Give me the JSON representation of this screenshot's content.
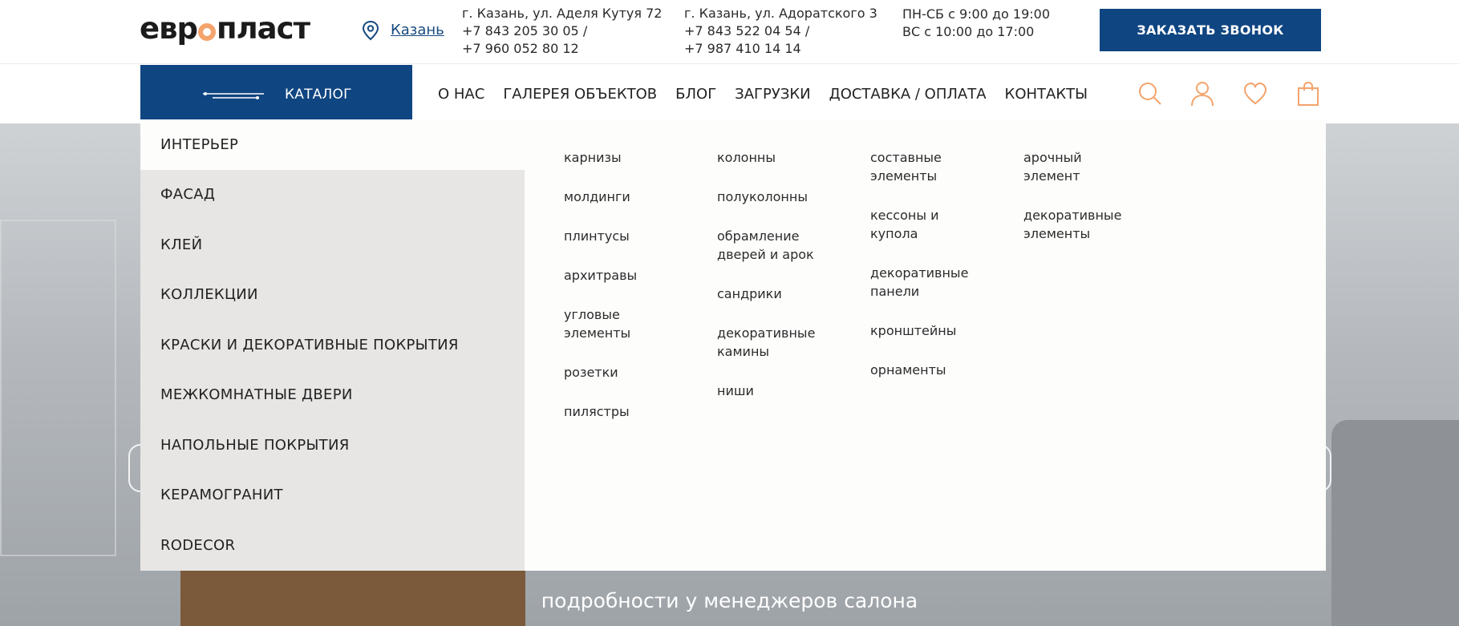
{
  "header": {
    "logo": {
      "before": "евр",
      "after": "пласт"
    },
    "city": "Казань",
    "address1": [
      "г. Казань, ул. Аделя Кутуя 72",
      "+7 843 205 30 05 /",
      "+7 960 052 80 12"
    ],
    "address2": [
      "г. Казань, ул. Адоратского 3",
      "+7 843 522 04 54 /",
      "+7 987 410 14 14"
    ],
    "hours": [
      "ПН-СБ с 9:00 до 19:00",
      "ВС с 10:00 до 17:00"
    ],
    "callback_label": "ЗАКАЗАТЬ ЗВОНОК"
  },
  "nav": {
    "catalog_label": "КАТАЛОГ",
    "links": [
      "О НАС",
      "ГАЛЕРЕЯ ОБЪЕКТОВ",
      "БЛОГ",
      "ЗАГРУЗКИ",
      "ДОСТАВКА / ОПЛАТА",
      "КОНТАКТЫ"
    ],
    "icons": [
      "search-icon",
      "user-icon",
      "heart-icon",
      "cart-icon"
    ]
  },
  "menu": {
    "categories": [
      "ИНТЕРЬЕР",
      "ФАСАД",
      "КЛЕЙ",
      "КОЛЛЕКЦИИ",
      "КРАСКИ И ДЕКОРАТИВНЫЕ ПОКРЫТИЯ",
      "МЕЖКОМНАТНЫЕ ДВЕРИ",
      "НАПОЛЬНЫЕ ПОКРЫТИЯ",
      "КЕРАМОГРАНИТ",
      "RODECOR"
    ],
    "active": "ИНТЕРЬЕР",
    "columns": [
      [
        [
          "карнизы"
        ],
        [
          "молдинги"
        ],
        [
          "плинтусы"
        ],
        [
          "архитравы"
        ],
        [
          "угловые",
          "элементы"
        ],
        [
          "розетки"
        ],
        [
          "пилястры"
        ]
      ],
      [
        [
          "колонны"
        ],
        [
          "полуколонны"
        ],
        [
          "обрамление",
          "дверей и арок"
        ],
        [
          "сандрики"
        ],
        [
          "декоративные",
          "камины"
        ],
        [
          "ниши"
        ]
      ],
      [
        [
          "составные",
          "элементы"
        ],
        [
          "кессоны и",
          "купола"
        ],
        [
          "декоративные",
          "панели"
        ],
        [
          "кронштейны"
        ],
        [
          "орнаменты"
        ]
      ],
      [
        [
          "арочный",
          "элемент"
        ],
        [
          "декоративные",
          "элементы"
        ]
      ]
    ]
  },
  "hero": {
    "line1": "(-- - --- -- -- -- ---- -- -- ---- ----)",
    "line2": "подробности у менеджеров салона"
  },
  "colors": {
    "brand": "#0f4581",
    "accent": "#f3a36b"
  }
}
